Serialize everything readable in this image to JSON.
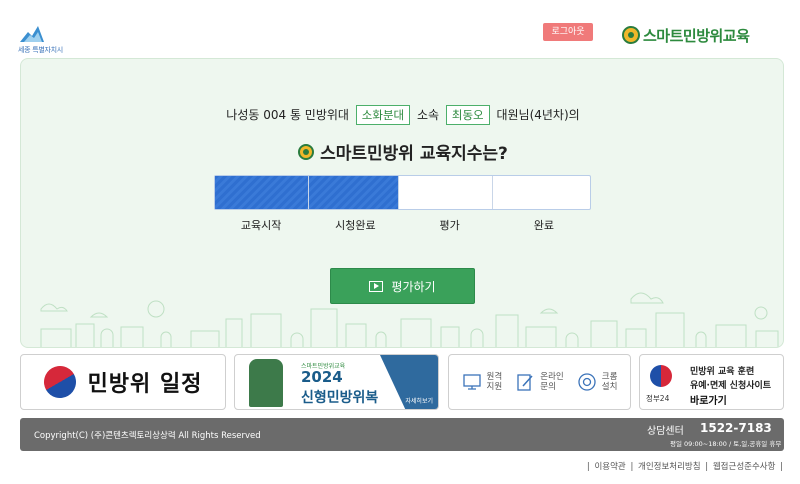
{
  "header": {
    "sejong_logo_text": "세종 특별자치시",
    "logout_label": "로그아웃",
    "brand_title": "스마트민방위교육"
  },
  "main": {
    "intro": {
      "prefix": "나성동 004 통 민방위대",
      "unit": "소화분대",
      "mid": "소속",
      "name": "최동오",
      "suffix": "대원님(4년차)의"
    },
    "question": "스마트민방위 교육지수는?",
    "progress": {
      "completed_fraction": 0.5
    },
    "steps": [
      "교육시작",
      "시청완료",
      "평가",
      "완료"
    ],
    "eval_button_label": "평가하기"
  },
  "banners": {
    "schedule": "민방위 일정",
    "uniform": {
      "small": "스마트민방위교육",
      "year": "2024",
      "name": "신형민방위복",
      "more": "자세히보기"
    },
    "support": [
      {
        "label_line1": "원격",
        "label_line2": "지원",
        "icon": "remote-support-icon"
      },
      {
        "label_line1": "온라인",
        "label_line2": "문의",
        "icon": "online-inquiry-icon"
      },
      {
        "label_line1": "크롬",
        "label_line2": "설치",
        "icon": "chrome-icon"
      }
    ],
    "gov": {
      "label": "정부24",
      "line1": "민방위 교육 훈련",
      "line2": "유예·면제 신청사이트",
      "line3": "바로가기"
    }
  },
  "footer": {
    "copyright": "Copyright(C) (주)콘텐츠렉토리상상력 All Rights Reserved",
    "cs_label": "상담센터",
    "cs_phone": "1522-7183",
    "cs_hours": "평일 09:00~18:00 / 토,일,공휴일 휴무"
  },
  "policy_links": [
    "이용약관",
    "개인정보처리방침",
    "웹접근성준수사항"
  ],
  "colors": {
    "brand_green": "#2d8a3e",
    "progress_blue": "#2f6fd0",
    "button_green": "#3aa15a",
    "logout_red": "#f07a7a"
  }
}
